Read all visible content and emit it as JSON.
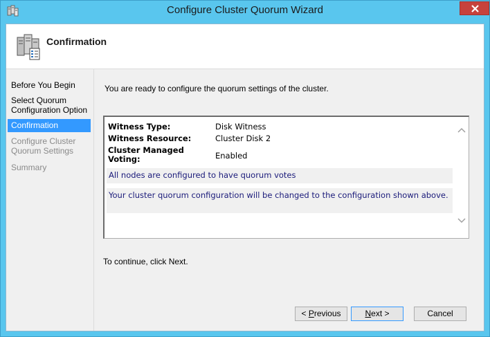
{
  "window": {
    "title": "Configure Cluster Quorum Wizard"
  },
  "header": {
    "title": "Confirmation"
  },
  "nav": {
    "items": [
      {
        "label": "Before You Begin",
        "state": "normal"
      },
      {
        "label": "Select Quorum Configuration Option",
        "state": "normal"
      },
      {
        "label": "Confirmation",
        "state": "active"
      },
      {
        "label": "Configure Cluster Quorum Settings",
        "state": "disabled"
      },
      {
        "label": "Summary",
        "state": "disabled"
      }
    ]
  },
  "main": {
    "intro": "You are ready to configure the quorum settings of the cluster.",
    "details": [
      {
        "label": "Witness Type:",
        "value": "Disk Witness"
      },
      {
        "label": "Witness Resource:",
        "value": "Cluster Disk 2"
      },
      {
        "label": "Cluster Managed Voting:",
        "value": "Enabled"
      }
    ],
    "messages": [
      "All nodes are configured to have quorum votes",
      "Your cluster quorum configuration will be changed to the configuration shown above."
    ],
    "continue_text": "To continue, click Next."
  },
  "buttons": {
    "previous": {
      "prefix": "< ",
      "key": "P",
      "rest": "revious"
    },
    "next": {
      "key": "N",
      "rest": "ext >"
    },
    "cancel": "Cancel"
  },
  "colors": {
    "titlebar": "#59c6ee",
    "close": "#c7423c",
    "selection": "#3399ff",
    "message_text": "#1a1a7a"
  }
}
